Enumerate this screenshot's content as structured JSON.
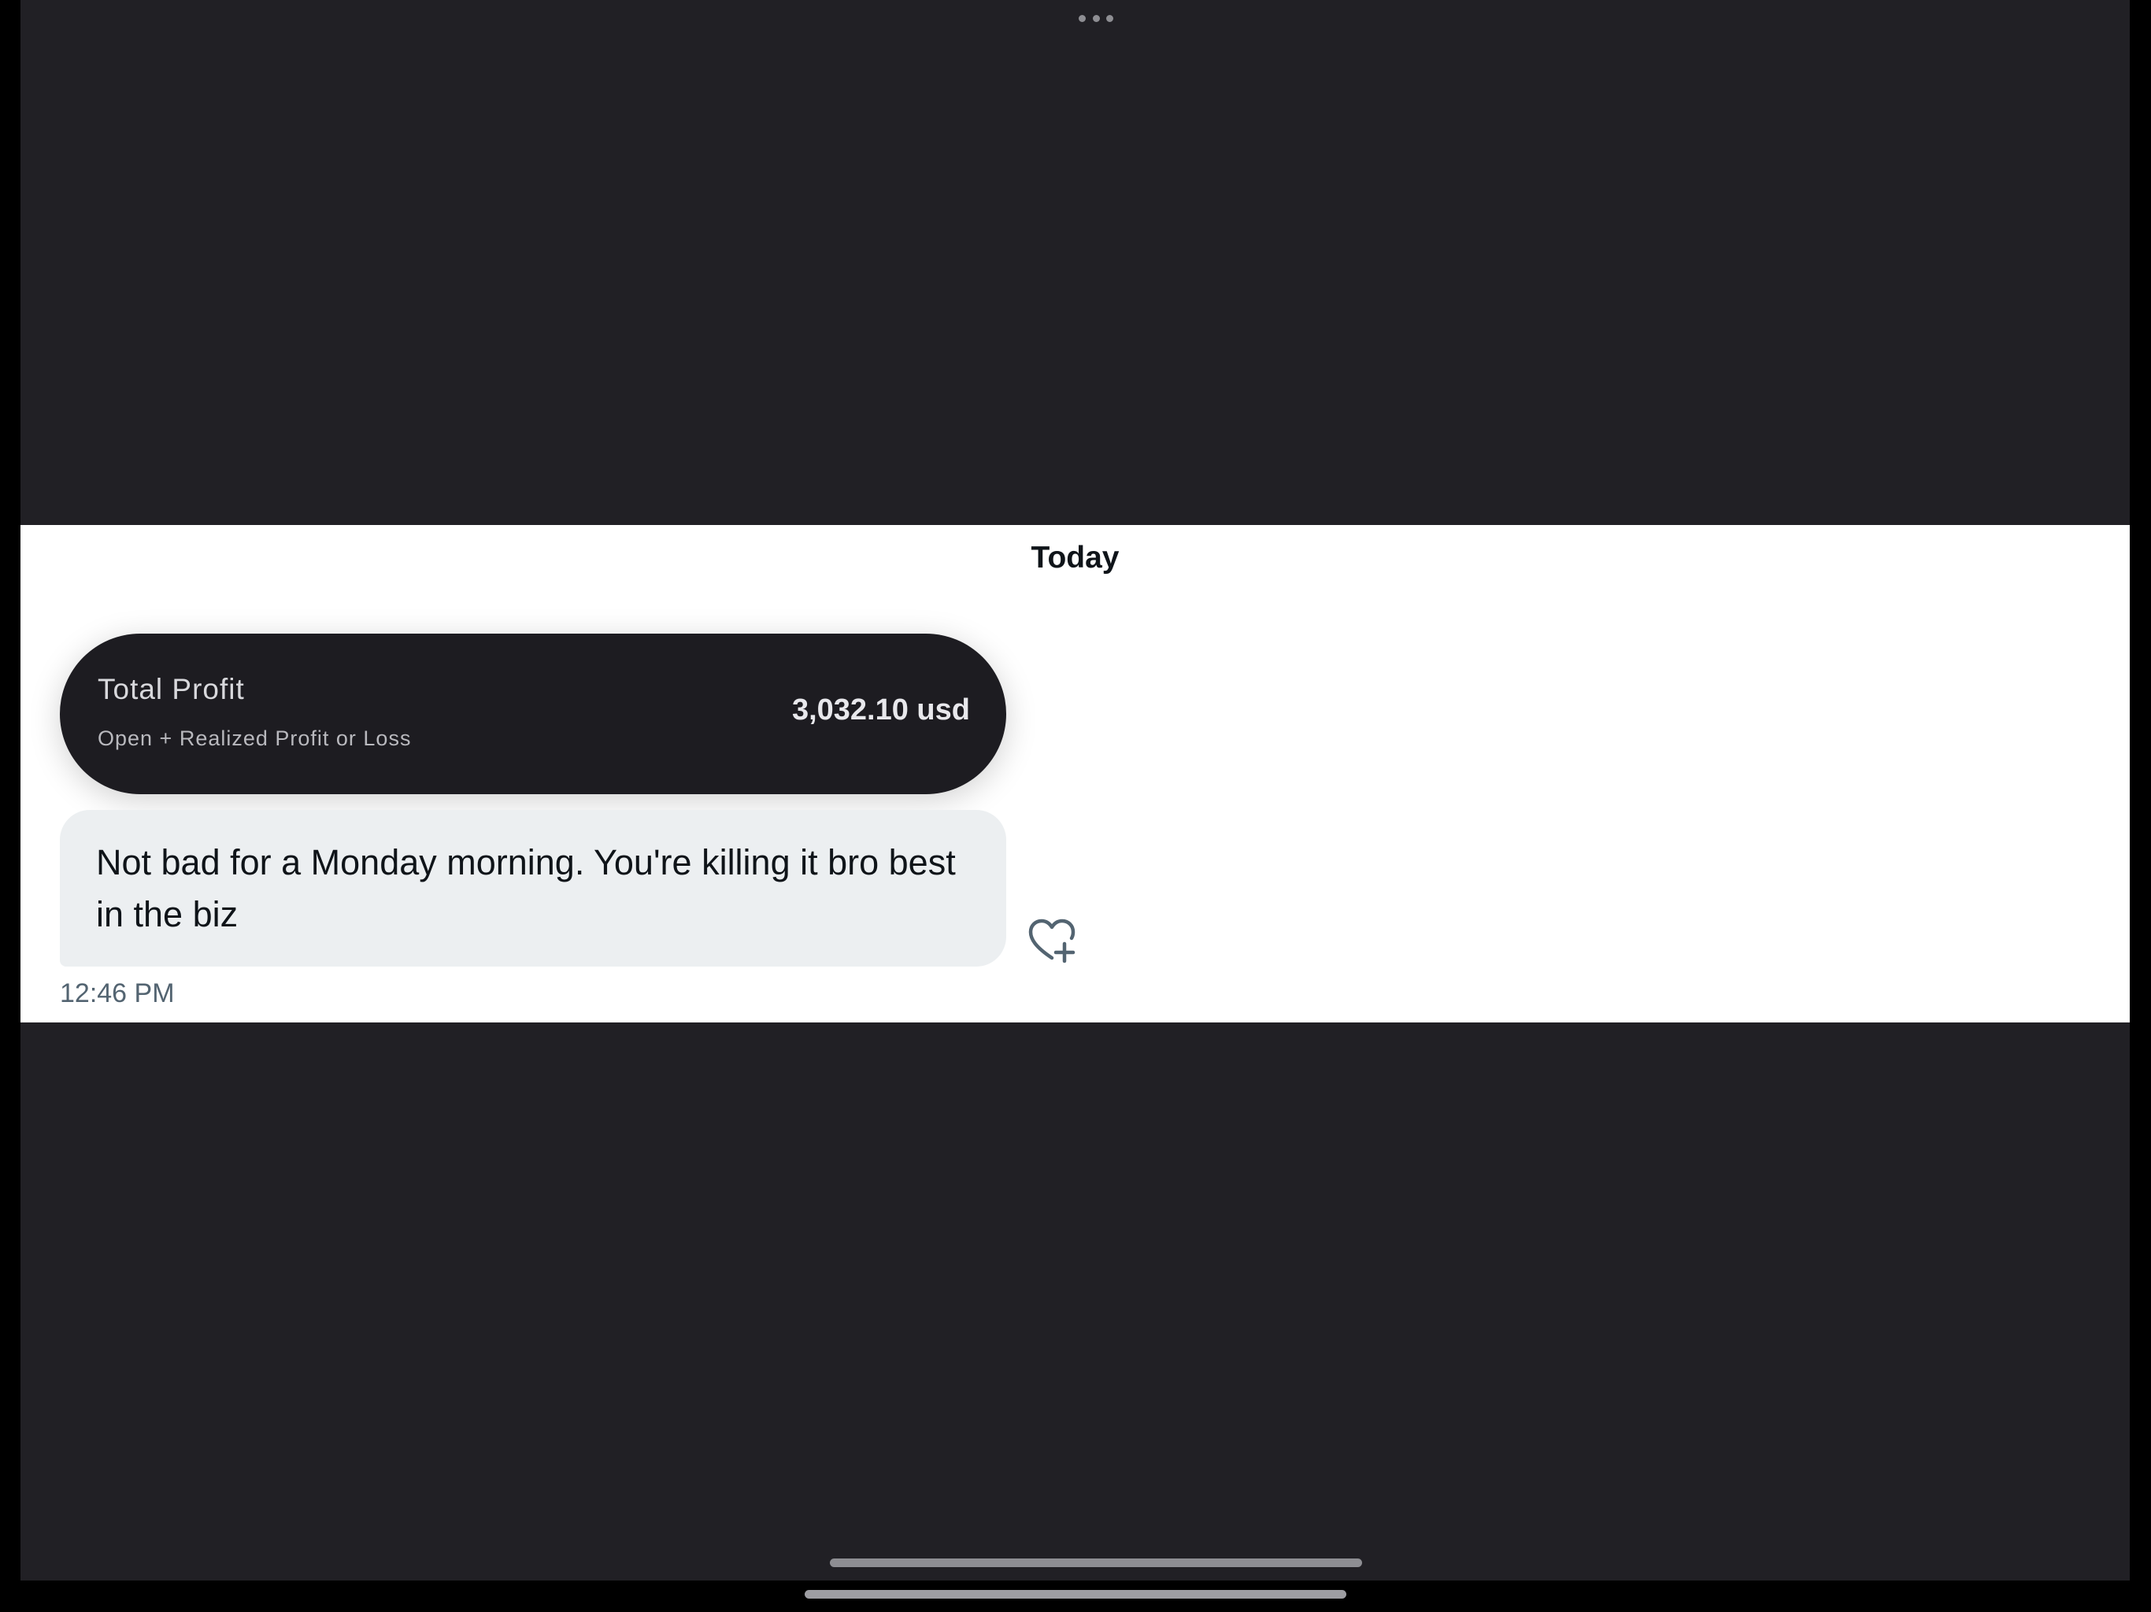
{
  "header": {
    "more_icon": "more-dots-icon"
  },
  "conversation": {
    "date_label": "Today",
    "profit_card": {
      "title": "Total Profit",
      "subtitle": "Open + Realized Profit or Loss",
      "value": "3,032.10 usd"
    },
    "message": {
      "text": "Not bad for a Monday morning. You're killing it bro best in the biz",
      "timestamp": "12:46 PM",
      "react_icon": "heart-plus-icon"
    }
  },
  "colors": {
    "background": "#212025",
    "panel": "#ffffff",
    "card": "#1d1c21",
    "bubble": "#eceff1",
    "timestamp": "#536471"
  }
}
